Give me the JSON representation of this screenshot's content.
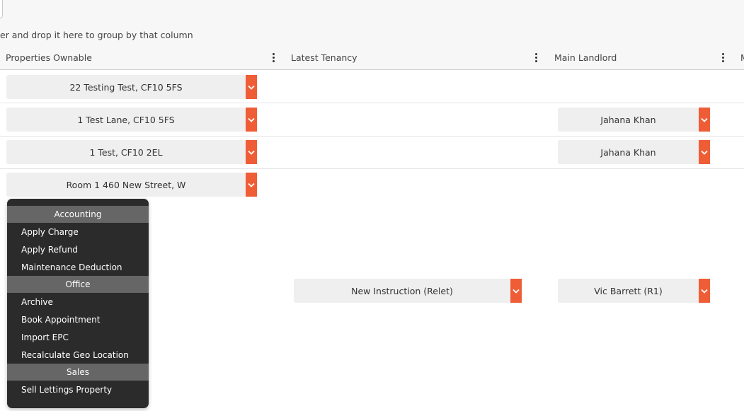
{
  "group_hint": "er and drop it here to group by that column",
  "columns": [
    {
      "label": "Properties Ownable"
    },
    {
      "label": "Latest Tenancy"
    },
    {
      "label": "Main Landlord"
    },
    {
      "label": "M"
    }
  ],
  "rows": [
    {
      "property": "22 Testing Test, CF10 5FS",
      "tenancy": "",
      "landlord": ""
    },
    {
      "property": "1 Test Lane, CF10 5FS",
      "tenancy": "",
      "landlord": "Jahana Khan"
    },
    {
      "property": "1 Test, CF10 2EL",
      "tenancy": "",
      "landlord": "Jahana Khan"
    },
    {
      "property": "Room 1 460 New Street, W",
      "tenancy": "",
      "landlord": ""
    },
    {
      "property": "",
      "tenancy": "New Instruction (Relet)",
      "landlord": "Vic Barrett (R1)"
    }
  ],
  "context_menu": {
    "sections": [
      {
        "title": "Accounting",
        "items": [
          "Apply Charge",
          "Apply Refund",
          "Maintenance Deduction"
        ]
      },
      {
        "title": "Office",
        "items": [
          "Archive",
          "Book Appointment",
          "Import EPC",
          "Recalculate Geo Location"
        ]
      },
      {
        "title": "Sales",
        "items": [
          "Sell Lettings Property"
        ]
      }
    ]
  },
  "colors": {
    "dropdown_accent": "#ef5d36",
    "menu_background": "#2b2b2b",
    "menu_section_header": "#666666"
  },
  "icons": {
    "column_menu": "kebab-icon",
    "dropdown": "chevron-down-icon"
  }
}
